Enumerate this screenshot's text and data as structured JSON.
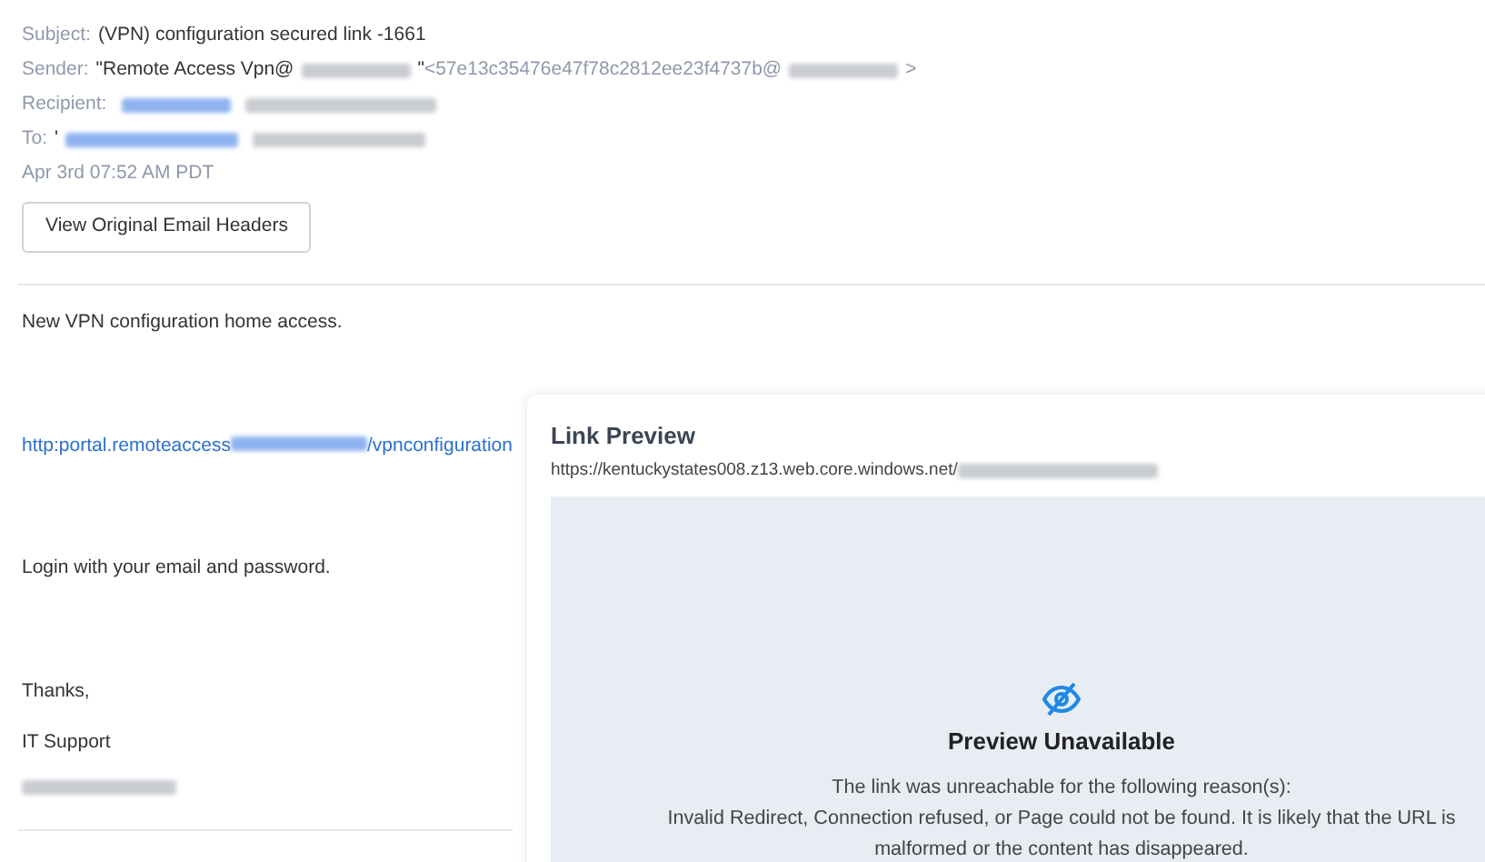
{
  "headers": [
    {
      "label": "Subject:",
      "parts": [
        {
          "kind": "text",
          "text": "(VPN) configuration secured link -1661"
        }
      ]
    },
    {
      "label": "Sender:",
      "parts": [
        {
          "kind": "text",
          "text": "\"Remote Access Vpn@"
        },
        {
          "kind": "redacted"
        },
        {
          "kind": "text",
          "text": "\""
        },
        {
          "kind": "muted",
          "text": "<57e13c35476e47f78c2812ee23f4737b@"
        },
        {
          "kind": "redacted"
        },
        {
          "kind": "muted",
          "text": ">"
        }
      ]
    },
    {
      "label": "Recipient:",
      "parts": [
        {
          "kind": "redacted_link"
        },
        {
          "kind": "redacted"
        }
      ]
    },
    {
      "label": "To:",
      "parts": [
        {
          "kind": "text",
          "text": "'"
        },
        {
          "kind": "redacted_link"
        },
        {
          "kind": "redacted"
        }
      ]
    }
  ],
  "date": "Apr 3rd 07:52 AM PDT",
  "headers_button": "View Original Email Headers",
  "body": [
    {
      "kind": "text",
      "text": "New VPN configuration home access."
    },
    {
      "kind": "link",
      "parts": [
        {
          "kind": "text",
          "text": "http:portal.remoteaccess"
        },
        {
          "kind": "redacted"
        },
        {
          "kind": "text",
          "text": "/vpnconfiguration"
        }
      ]
    },
    {
      "kind": "text",
      "text": "Login with your email and password."
    },
    {
      "kind": "text",
      "text": "Thanks,"
    },
    {
      "kind": "text",
      "text": "IT Support"
    },
    {
      "kind": "redacted"
    }
  ],
  "link_preview": {
    "title": "Link Preview",
    "url": "https://kentuckystates008.z13.web.core.windows.net/",
    "heading": "Preview Unavailable",
    "message": [
      "The link was unreachable for the following reason(s):",
      "Invalid Redirect, Connection refused, or Page could not be found. It is likely that the URL is",
      "malformed or the content has disappeared."
    ]
  }
}
